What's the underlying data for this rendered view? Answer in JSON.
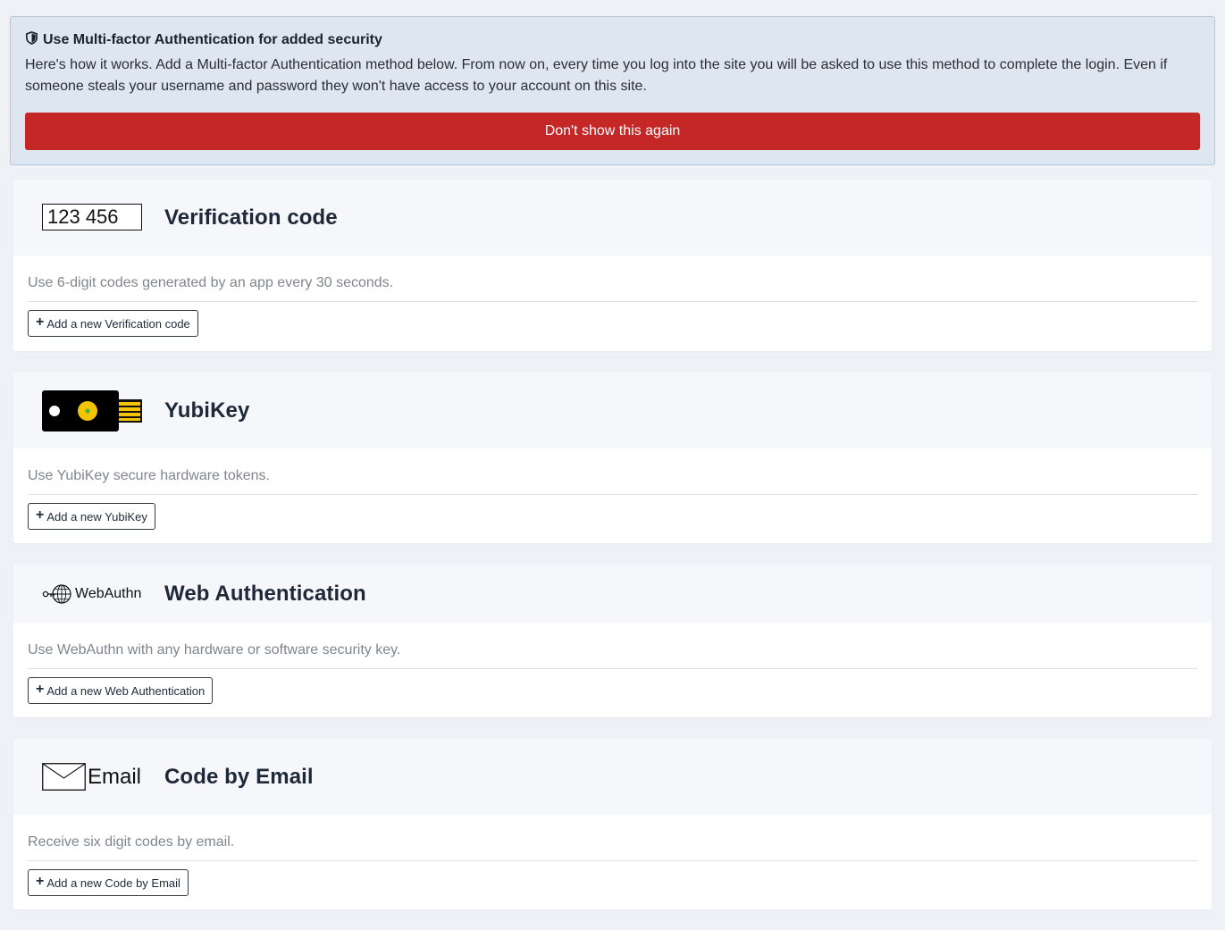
{
  "alert": {
    "title": "Use Multi-factor Authentication for added security",
    "text": "Here's how it works. Add a Multi-factor Authentication method below. From now on, every time you log into the site you will be asked to use this method to complete the login. Even if someone steals your username and password they won't have access to your account on this site.",
    "dismiss_label": "Don't show this again",
    "dismiss_color": "#c52727",
    "icon": "shield-icon"
  },
  "methods": [
    {
      "logo_text": "123 456",
      "title": "Verification code",
      "description": "Use 6-digit codes generated by an app every 30 seconds.",
      "add_label": "Add a new Verification code"
    },
    {
      "logo_text": "",
      "title": "YubiKey",
      "description": "Use YubiKey secure hardware tokens.",
      "add_label": "Add a new YubiKey"
    },
    {
      "logo_text": "WebAuthn",
      "title": "Web Authentication",
      "description": "Use WebAuthn with any hardware or software security key.",
      "add_label": "Add a new Web Authentication"
    },
    {
      "logo_text": "Email",
      "title": "Code by Email",
      "description": "Receive six digit codes by email.",
      "add_label": "Add a new Code by Email"
    }
  ],
  "colors": {
    "page_bg": "#eef2f6",
    "alert_bg": "#dee6f2",
    "header_bg": "#f5f7fa",
    "yubikey_gold": "#f5c400"
  }
}
